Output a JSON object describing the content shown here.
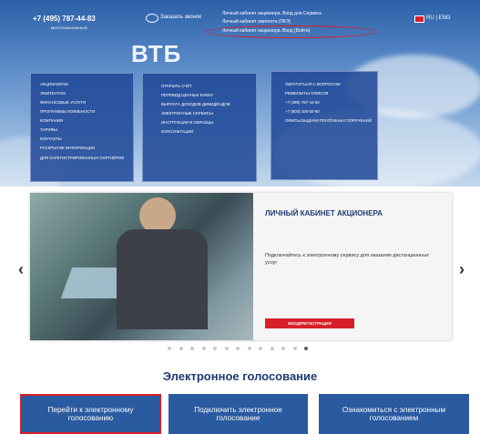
{
  "header": {
    "phone": "+7 (495) 787-44-83",
    "phone_sub": "МНОГОКАНАЛЬНЫЙ",
    "callback": "Заказать звонок",
    "notice_line1": "Личный кабинет акционера. Вход для Сервиса",
    "notice_line2": "Личный кабинет эмитента (ЛКЭ)",
    "notice_line3": "Личный кабинет акционера. Вход (Войти)",
    "lang": "RU | ENG",
    "logo": "ВТБ"
  },
  "menu": {
    "col1": [
      "АКЦИОНЕРАМ",
      "ЭМИТЕНТАМ",
      "ФИНАНСОВЫЕ УСЛУГИ",
      "ПРОГРАММЫ ЛОЯЛЬНОСТИ",
      "КОМПАНИЯ",
      "ТАРИФЫ",
      "КОНТАКТЫ",
      "РАСКРЫТИЕ ИНФОРМАЦИИ",
      "ДЛЯ ЗАРЕГИСТРИРОВАННЫХ ПАРТНЁРОВ"
    ],
    "col2": [
      "ОТКРЫТЬ СЧЁТ",
      "ПЕРЕВОД ЦЕННЫХ БУМАГ",
      "ВЫПЛАТА ДОХОДОВ ДИВИДЕНДОВ",
      "ЭЛЕКТРОННЫЕ СЕРВИСЫ",
      "ИНСТРУКЦИИ И ОБРАЗЦЫ",
      "КОНСУЛЬТАЦИИ"
    ],
    "col3": [
      "ОБРАТИТЬСЯ С ВОПРОСОМ",
      "РЕКВИЗИТЫ ОФИСОВ",
      "+7 (495) 787-44-83",
      "+7 (800) 100-50-80",
      "ОФИСЫ ВЫДАЧИ ПЛАТЁЖНЫХ ПОРУЧЕНИЙ"
    ]
  },
  "slider": {
    "title": "ЛИЧНЫЙ КАБИНЕТ АКЦИОНЕРА",
    "text": "Подключайтесь к электронному сервису для оказания дистанционных услуг",
    "button": "ВХОД/РЕГИСТРАЦИЯ",
    "left_arrow": "‹",
    "right_arrow": "›",
    "dots_total": 13,
    "dot_active_index": 12
  },
  "main": {
    "title": "Электронное голосование",
    "cta1": "Перейти к электронному голосованию",
    "cta2": "Подключить электронное голосование",
    "cta3": "Ознакомиться с электронным голосованием"
  },
  "colors": {
    "brand_blue": "#2a5aa0",
    "accent_red": "#d8202a",
    "title_blue": "#1f3b73"
  }
}
